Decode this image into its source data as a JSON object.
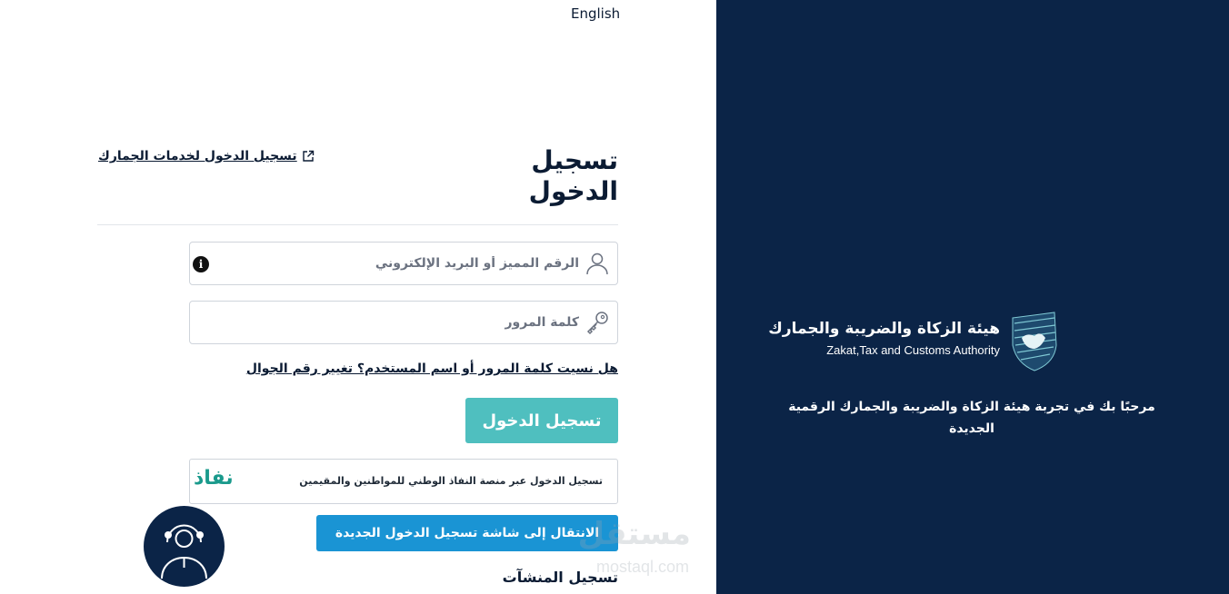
{
  "header": {
    "language_link": "English"
  },
  "login": {
    "title": "تسجيل الدخول",
    "customs_link": "تسجيل الدخول لخدمات الجمارك",
    "username_placeholder": "الرقم المميز أو البريد الإلكتروني",
    "password_placeholder": "كلمة المرور",
    "forgot_text": "هل نسيت كلمة المرور أو اسم المستخدم؟ تغيير رقم الجوال",
    "submit_label": "تسجيل الدخول",
    "nafath_text": "تسجيل الدخول عبر منصة النفاذ الوطني للمواطنين والمقيمين",
    "nafath_logo": "نفاذ",
    "new_login_label": "الانتقال إلى شاشة تسجيل الدخول الجديدة",
    "establishments_heading": "تسجيل المنشآت"
  },
  "panel": {
    "logo_ar": "هيئة الزكاة والضريبة والجمارك",
    "logo_en": "Zakat,Tax and Customs Authority",
    "welcome": "مرحبًا بك في تجربة هيئة الزكاة والضريبة والجمارك الرقمية الجديدة",
    "background_color": "#0b2447"
  },
  "colors": {
    "primary_button": "#4fbfbf",
    "secondary_button": "#1a94d4",
    "nafath_green": "#1a9a8c"
  },
  "watermark": {
    "ar": "مستقل",
    "en": "mostaql.com"
  },
  "icons": {
    "external": "external-link-icon",
    "user": "user-icon",
    "key": "key-icon",
    "info": "info-icon",
    "support": "support-agent-icon"
  }
}
